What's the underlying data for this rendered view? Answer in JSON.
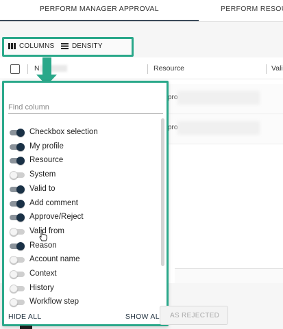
{
  "tabs": [
    {
      "label": "PERFORM MANAGER APPROVAL",
      "active": true
    },
    {
      "label": "PERFORM RESOU",
      "active": false
    }
  ],
  "toolbar": {
    "columns_label": "COLUMNS",
    "columns_icon": "columns-icon",
    "density_label": "DENSITY",
    "density_icon": "density-icon"
  },
  "grid": {
    "headers": [
      "N",
      "Resource",
      "Vali"
    ],
    "row_fragments": [
      "pro",
      "pro"
    ]
  },
  "column_panel": {
    "search_placeholder": "Find column",
    "search_value": "",
    "columns": [
      {
        "label": "Checkbox selection",
        "visible": true
      },
      {
        "label": "My profile",
        "visible": true
      },
      {
        "label": "Resource",
        "visible": true
      },
      {
        "label": "System",
        "visible": false
      },
      {
        "label": "Valid to",
        "visible": true
      },
      {
        "label": "Add comment",
        "visible": true
      },
      {
        "label": "Approve/Reject",
        "visible": true
      },
      {
        "label": "Valid from",
        "visible": false
      },
      {
        "label": "Reason",
        "visible": true
      },
      {
        "label": "Account name",
        "visible": false
      },
      {
        "label": "Context",
        "visible": false
      },
      {
        "label": "History",
        "visible": false
      },
      {
        "label": "Workflow step",
        "visible": false
      }
    ],
    "hide_all_label": "HIDE ALL",
    "show_all_label": "SHOW ALL"
  },
  "footer": {
    "reject_button_label": "AS REJECTED"
  },
  "colors": {
    "highlight": "#2aa88a",
    "toggle_on": "#1a3146",
    "tab_underline": "#3b4a5a"
  }
}
